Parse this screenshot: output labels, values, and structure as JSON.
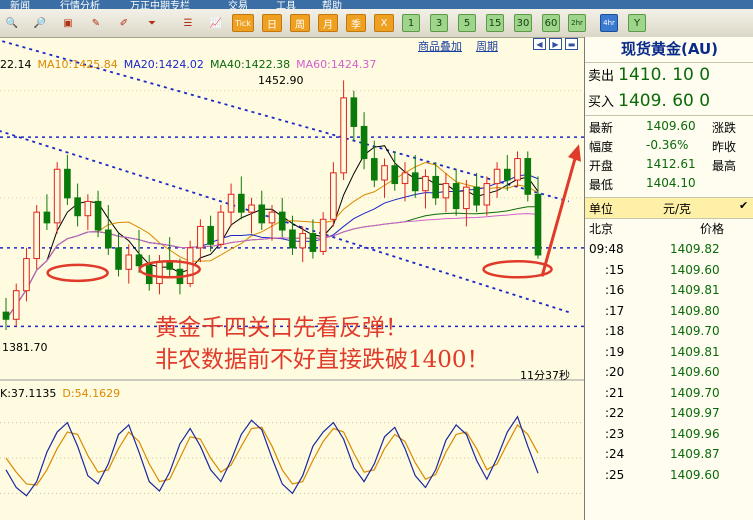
{
  "menu": {
    "items": [
      "新闻",
      "行情分析",
      "万正中期专栏",
      "交易",
      "工具",
      "帮助"
    ]
  },
  "toolbar": {
    "icons": [
      "zoom-in-icon",
      "zoom-out-icon",
      "window-icon",
      "pen-icon",
      "draw-icon",
      "filter-icon",
      "list-icon",
      "indicator-icon"
    ],
    "tick": "Tick",
    "periods": [
      "日",
      "周",
      "月",
      "季",
      "X"
    ],
    "minutes": [
      "1",
      "3",
      "5",
      "15",
      "30",
      "60",
      "2hr",
      "4hr",
      "Y"
    ],
    "selected": "4hr"
  },
  "chart": {
    "ma_legend": [
      {
        "text": "22.14",
        "color": "#000000"
      },
      {
        "text": "MA10:1425.84",
        "color": "#d98a00"
      },
      {
        "text": "MA20:1424.02",
        "color": "#1a28c8"
      },
      {
        "text": "MA40:1422.38",
        "color": "#0a6a0a"
      },
      {
        "text": "MA60:1424.37",
        "color": "#d060d0"
      }
    ],
    "links": [
      "商品叠加",
      "周期"
    ],
    "nav_icons": [
      "back-icon",
      "forward-icon",
      "minimize-icon"
    ],
    "high_label": "1452.90",
    "low_label": "1381.70",
    "countdown": "11分37秒",
    "kd_legend": [
      {
        "text": "K:37.1135",
        "color": "#000000"
      },
      {
        "text": "D:54.1629",
        "color": "#d98a00"
      }
    ],
    "annotation": [
      "黄金千四关口先看反弹！",
      "非农数据前不好直接跌破1400！"
    ],
    "colors": {
      "up": "#e0241c",
      "down": "#0a7a0a",
      "annotation": "#e03a2a",
      "trendline": "#1a28c8"
    }
  },
  "chart_data": {
    "type": "candlestick",
    "instrument": "现货黄金(AU)",
    "period": "4hr",
    "ylim": [
      1376,
      1460
    ],
    "price_high": 1452.9,
    "price_low": 1381.7,
    "candles_ohlc": [
      [
        1388,
        1392,
        1383,
        1386
      ],
      [
        1386,
        1396,
        1384,
        1394
      ],
      [
        1394,
        1406,
        1391,
        1403
      ],
      [
        1403,
        1418,
        1400,
        1416
      ],
      [
        1416,
        1421,
        1411,
        1413
      ],
      [
        1413,
        1430,
        1410,
        1428
      ],
      [
        1428,
        1432,
        1418,
        1420
      ],
      [
        1420,
        1424,
        1412,
        1415
      ],
      [
        1415,
        1421,
        1411,
        1419
      ],
      [
        1419,
        1422,
        1409,
        1411
      ],
      [
        1411,
        1418,
        1404,
        1406
      ],
      [
        1406,
        1410,
        1398,
        1400
      ],
      [
        1400,
        1407,
        1396,
        1404
      ],
      [
        1404,
        1411,
        1399,
        1401
      ],
      [
        1401,
        1404,
        1394,
        1396
      ],
      [
        1396,
        1404,
        1393,
        1402
      ],
      [
        1402,
        1409,
        1398,
        1400
      ],
      [
        1400,
        1403,
        1393,
        1396
      ],
      [
        1396,
        1408,
        1395,
        1406
      ],
      [
        1406,
        1414,
        1402,
        1412
      ],
      [
        1412,
        1415,
        1405,
        1407
      ],
      [
        1407,
        1418,
        1406,
        1416
      ],
      [
        1416,
        1424,
        1412,
        1421
      ],
      [
        1421,
        1426,
        1414,
        1416
      ],
      [
        1416,
        1420,
        1410,
        1418
      ],
      [
        1418,
        1422,
        1411,
        1413
      ],
      [
        1413,
        1418,
        1408,
        1416
      ],
      [
        1416,
        1420,
        1409,
        1411
      ],
      [
        1411,
        1415,
        1404,
        1406
      ],
      [
        1406,
        1412,
        1402,
        1410
      ],
      [
        1410,
        1414,
        1403,
        1405
      ],
      [
        1405,
        1416,
        1404,
        1414
      ],
      [
        1414,
        1430,
        1412,
        1427
      ],
      [
        1427,
        1452.9,
        1425,
        1448
      ],
      [
        1448,
        1450,
        1436,
        1440
      ],
      [
        1440,
        1444,
        1428,
        1431
      ],
      [
        1431,
        1436,
        1423,
        1425
      ],
      [
        1425,
        1431,
        1420,
        1429
      ],
      [
        1429,
        1433,
        1422,
        1424
      ],
      [
        1424,
        1430,
        1419,
        1427
      ],
      [
        1427,
        1432,
        1420,
        1422
      ],
      [
        1422,
        1428,
        1417,
        1426
      ],
      [
        1426,
        1430,
        1418,
        1420
      ],
      [
        1420,
        1427,
        1416,
        1424
      ],
      [
        1424,
        1428,
        1415,
        1417
      ],
      [
        1417,
        1425,
        1412,
        1423
      ],
      [
        1423,
        1427,
        1416,
        1418
      ],
      [
        1418,
        1426,
        1415,
        1424
      ],
      [
        1424,
        1430,
        1420,
        1428
      ],
      [
        1428,
        1432,
        1422,
        1425
      ],
      [
        1425,
        1433,
        1423,
        1431
      ],
      [
        1431,
        1433,
        1419,
        1421
      ],
      [
        1421,
        1426,
        1403,
        1404
      ]
    ],
    "horizontal_levels": [
      1437,
      1406,
      1384
    ],
    "kd": {
      "K": [
        40,
        25,
        18,
        30,
        55,
        72,
        80,
        60,
        35,
        28,
        45,
        70,
        78,
        55,
        30,
        22,
        38,
        62,
        75,
        60,
        40,
        30,
        48,
        70,
        82,
        74,
        50,
        28,
        20,
        35,
        60,
        72,
        80,
        66,
        42,
        30,
        45,
        68,
        76,
        58,
        35,
        25,
        40,
        65,
        78,
        70,
        48,
        32,
        50,
        72,
        85,
        60,
        37.1135
      ],
      "D": [
        50,
        38,
        28,
        27,
        40,
        58,
        72,
        70,
        52,
        38,
        40,
        58,
        72,
        64,
        45,
        30,
        32,
        50,
        68,
        66,
        50,
        38,
        44,
        60,
        75,
        76,
        60,
        40,
        28,
        30,
        48,
        64,
        75,
        72,
        54,
        38,
        40,
        58,
        70,
        64,
        46,
        32,
        36,
        55,
        70,
        72,
        58,
        40,
        45,
        62,
        78,
        70,
        54.1629
      ]
    }
  },
  "quote": {
    "title": "现货黄金(AU)",
    "sell_label": "卖出",
    "sell_value": "1410. 10 0",
    "buy_label": "买入",
    "buy_value": "1409. 60 0",
    "stats": [
      {
        "label": "最新",
        "value": "1409.60",
        "label2": "涨跌"
      },
      {
        "label": "幅度",
        "value": "-0.36%",
        "label2": "昨收"
      },
      {
        "label": "开盘",
        "value": "1412.61",
        "label2": "最高"
      },
      {
        "label": "最低",
        "value": "1404.10",
        "label2": ""
      }
    ],
    "unit_label": "单位",
    "unit_value": "元/克",
    "location": "北京",
    "price_header": "价格",
    "ticks": [
      {
        "time": "09:48",
        "price": "1409.82"
      },
      {
        "time": ":15",
        "price": "1409.60"
      },
      {
        "time": ":16",
        "price": "1409.81"
      },
      {
        "time": ":17",
        "price": "1409.80"
      },
      {
        "time": ":18",
        "price": "1409.70"
      },
      {
        "time": ":19",
        "price": "1409.81"
      },
      {
        "time": ":20",
        "price": "1409.60"
      },
      {
        "time": ":21",
        "price": "1409.70"
      },
      {
        "time": ":22",
        "price": "1409.97"
      },
      {
        "time": ":23",
        "price": "1409.96"
      },
      {
        "time": ":24",
        "price": "1409.87"
      },
      {
        "time": ":25",
        "price": "1409.60"
      }
    ]
  }
}
